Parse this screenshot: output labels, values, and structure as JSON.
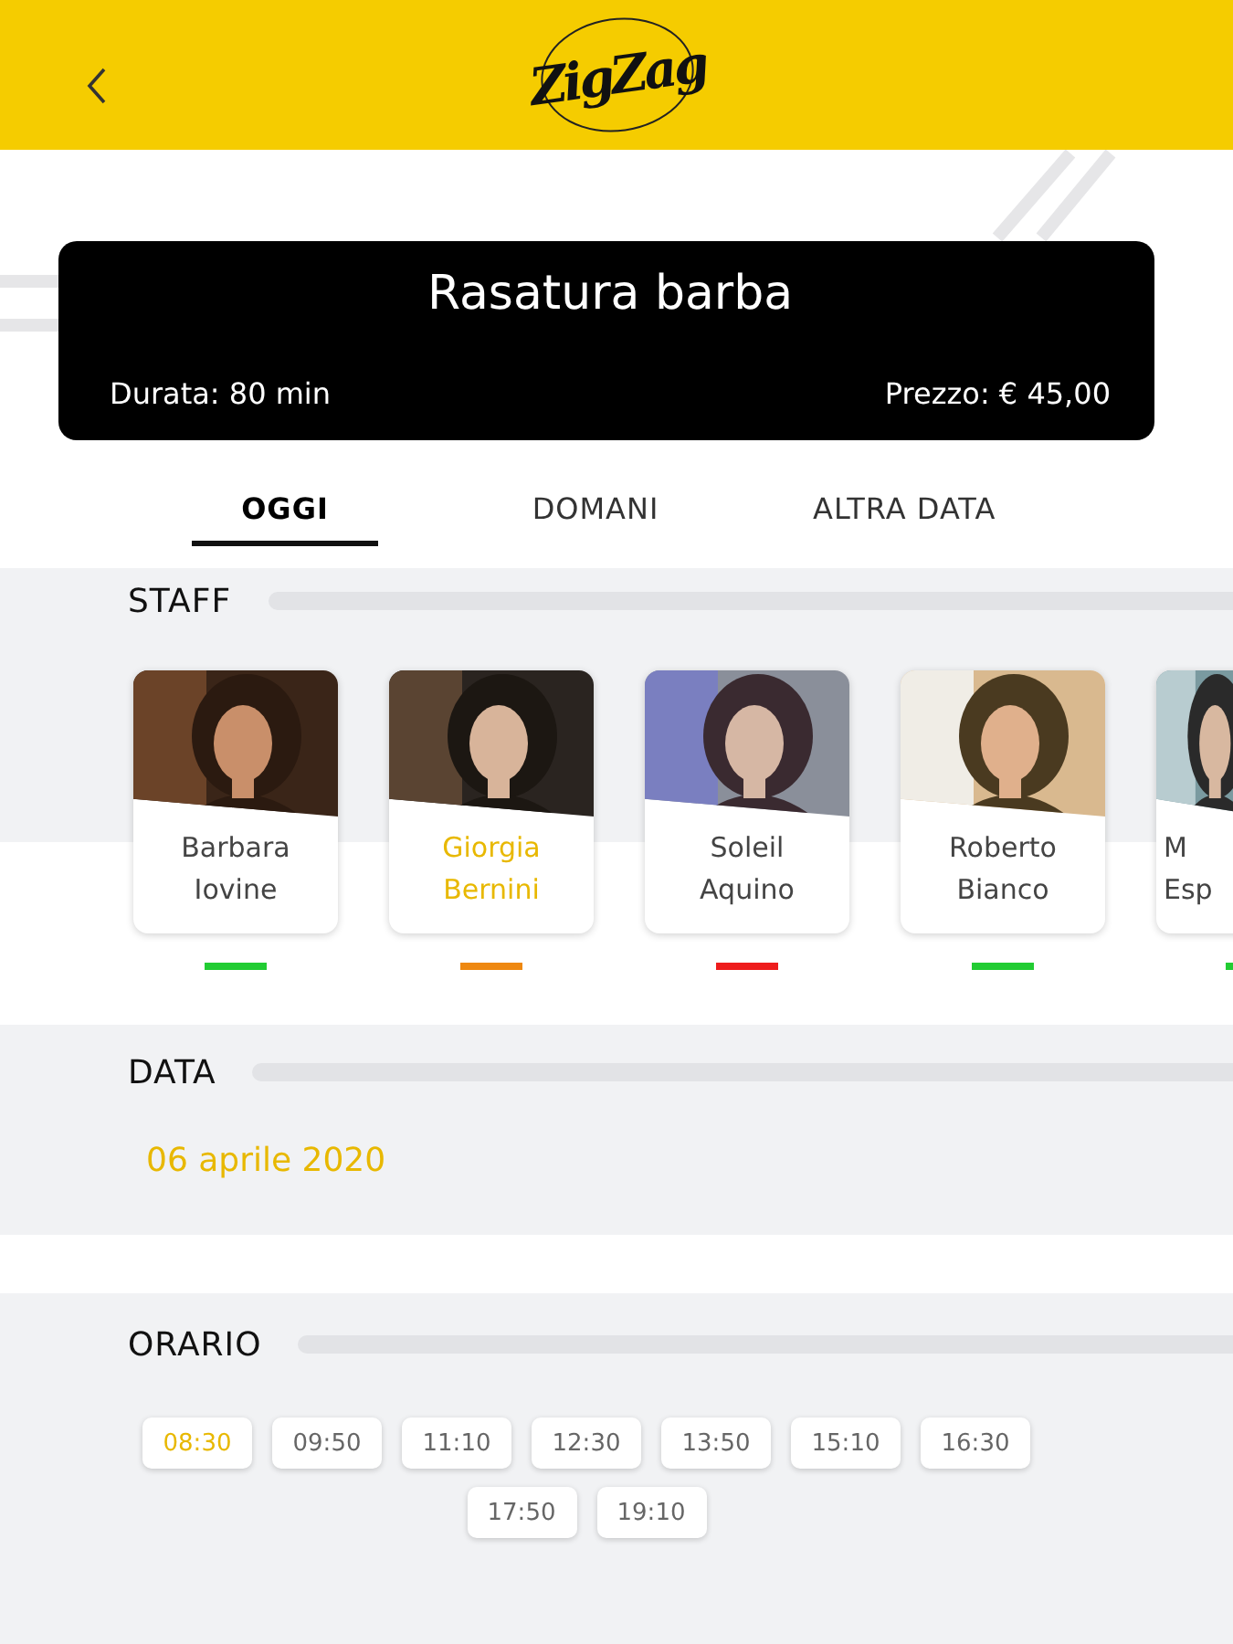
{
  "header": {
    "logo": "ZigZag"
  },
  "service": {
    "title": "Rasatura barba",
    "duration": "Durata: 80 min",
    "price": "Prezzo: € 45,00"
  },
  "tabs": [
    {
      "label": "OGGI",
      "selected": true
    },
    {
      "label": "DOMANI",
      "selected": false
    },
    {
      "label": "ALTRA DATA",
      "selected": false
    }
  ],
  "staff": {
    "title": "STAFF",
    "members": [
      {
        "kind": "full",
        "name": "Barbara Iovine",
        "selected": false,
        "color": "#22cc33"
      },
      {
        "kind": "full",
        "name": "Giorgia Bernini",
        "selected": true,
        "color": "#ee8811"
      },
      {
        "kind": "full",
        "name": "Soleil Aquino",
        "selected": false,
        "color": "#ee1c1c"
      },
      {
        "kind": "full",
        "name": "Roberto Bianco",
        "selected": false,
        "color": "#22cc33"
      },
      {
        "kind": "cut",
        "name": "M Esp",
        "selected": false,
        "color": "#22cc33"
      }
    ]
  },
  "date": {
    "title": "DATA",
    "value": "06 aprile 2020"
  },
  "times": {
    "title": "ORARIO",
    "slots": [
      {
        "label": "08:30",
        "selected": true
      },
      {
        "label": "09:50",
        "selected": false
      },
      {
        "label": "11:10",
        "selected": false
      },
      {
        "label": "12:30",
        "selected": false
      },
      {
        "label": "13:50",
        "selected": false
      },
      {
        "label": "15:10",
        "selected": false
      },
      {
        "label": "16:30",
        "selected": false
      },
      {
        "label": "17:50",
        "selected": false
      },
      {
        "label": "19:10",
        "selected": false
      }
    ]
  }
}
